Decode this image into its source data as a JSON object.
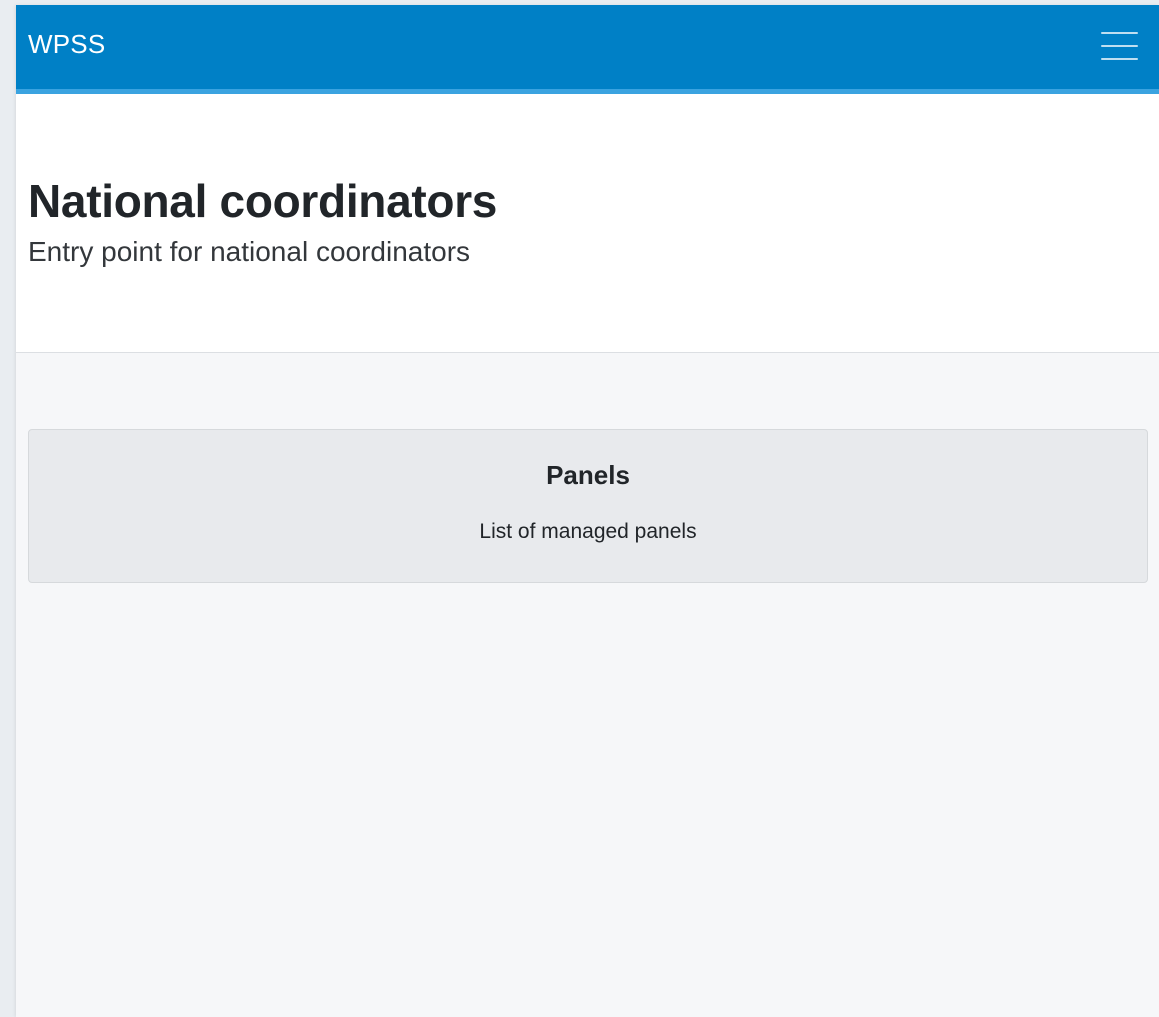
{
  "navbar": {
    "brand": "WPSS",
    "menu_icon": "hamburger-menu-icon",
    "background_color": "#0080c6"
  },
  "header": {
    "title": "National coordinators",
    "subtitle": "Entry point for national coordinators"
  },
  "cards": [
    {
      "title": "Panels",
      "description": "List of managed panels"
    }
  ]
}
